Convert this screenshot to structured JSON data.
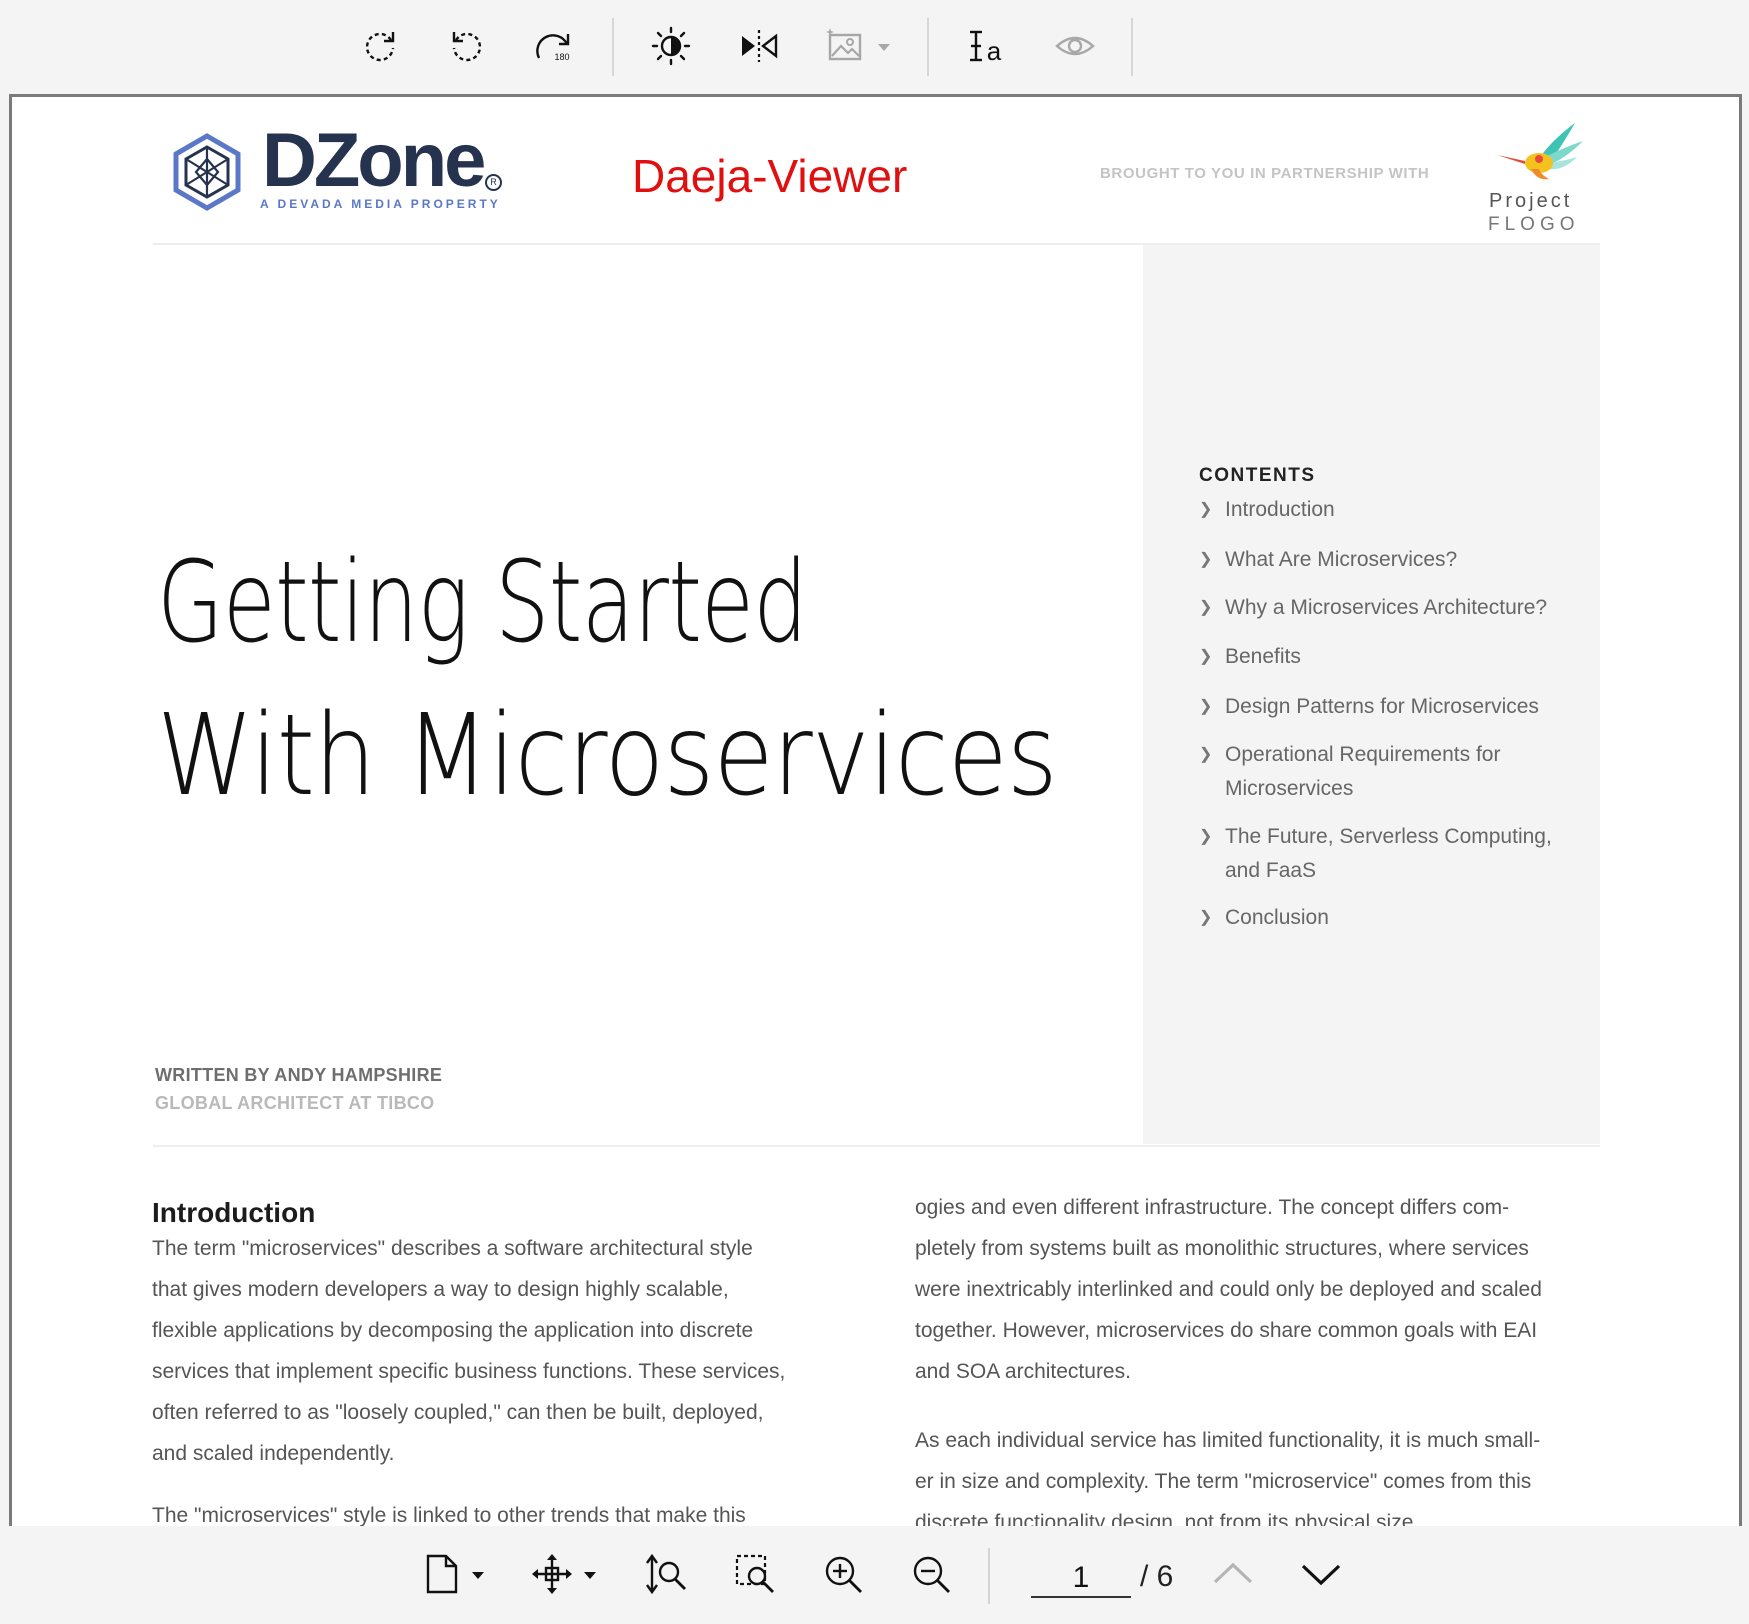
{
  "toolbar": {
    "items": [
      {
        "name": "rotate-clockwise"
      },
      {
        "name": "rotate-counterclockwise"
      },
      {
        "name": "rotate-180",
        "label": "180"
      },
      {
        "name": "brightness"
      },
      {
        "name": "flip-horizontal"
      },
      {
        "name": "image-enhance",
        "enabled": false
      },
      {
        "name": "text-select"
      },
      {
        "name": "show-hide",
        "enabled": false
      }
    ]
  },
  "document": {
    "publisher": "DZone",
    "publisher_sub": "A DEVADA MEDIA PROPERTY",
    "viewer_label": "Daeja-Viewer",
    "partnership": "BROUGHT TO YOU IN PARTNERSHIP WITH",
    "partner_name_1": "Project",
    "partner_name_2": "FLOGO",
    "title_line1": "Getting Started",
    "title_line2": "With Microservices",
    "author": "WRITTEN BY ANDY HAMPSHIRE",
    "author_role": "GLOBAL ARCHITECT AT TIBCO",
    "contents_heading": "CONTENTS",
    "contents": [
      "Introduction",
      "What Are Microservices?",
      "Why a Microservices Architecture?",
      "Benefits",
      "Design Patterns for Microservices",
      "Operational Requirements for Microservices",
      "The Future, Serverless Computing, and FaaS",
      "Conclusion"
    ],
    "intro_heading": "Introduction",
    "col1_lines": [
      "The term \"microservices\" describes a software architectural style",
      "that gives modern developers a way to design highly scalable,",
      "flexible applications by decomposing the application into discrete",
      "services that implement specific business functions. These services,",
      "often referred to as \"loosely coupled,\" can then be built, deployed,",
      "and scaled independently."
    ],
    "col1_cut_line": "The \"microservices\" style is linked to other trends that make this",
    "col2_lines_a": [
      "ogies and even different infrastructure. The concept differs com-",
      "pletely from systems built as monolithic structures, where services",
      "were inextricably interlinked and could only be deployed and scaled",
      "together. However, microservices do share common goals with EAI",
      "and SOA architectures."
    ],
    "col2_lines_b": [
      "As each individual service has limited functionality, it is much small-",
      "er in size and complexity. The term \"microservice\" comes from this",
      "discrete functionality design, not from its physical size."
    ]
  },
  "bottombar": {
    "current_page": "1",
    "total_pages": "/ 6",
    "items": [
      "page-view",
      "pan",
      "fit-height",
      "zoom-selection",
      "zoom-in",
      "zoom-out",
      "previous-page",
      "next-page"
    ]
  },
  "colors": {
    "accent_red": "#e01010",
    "dzone_navy": "#26334f",
    "panel_gray": "#f4f4f4"
  }
}
